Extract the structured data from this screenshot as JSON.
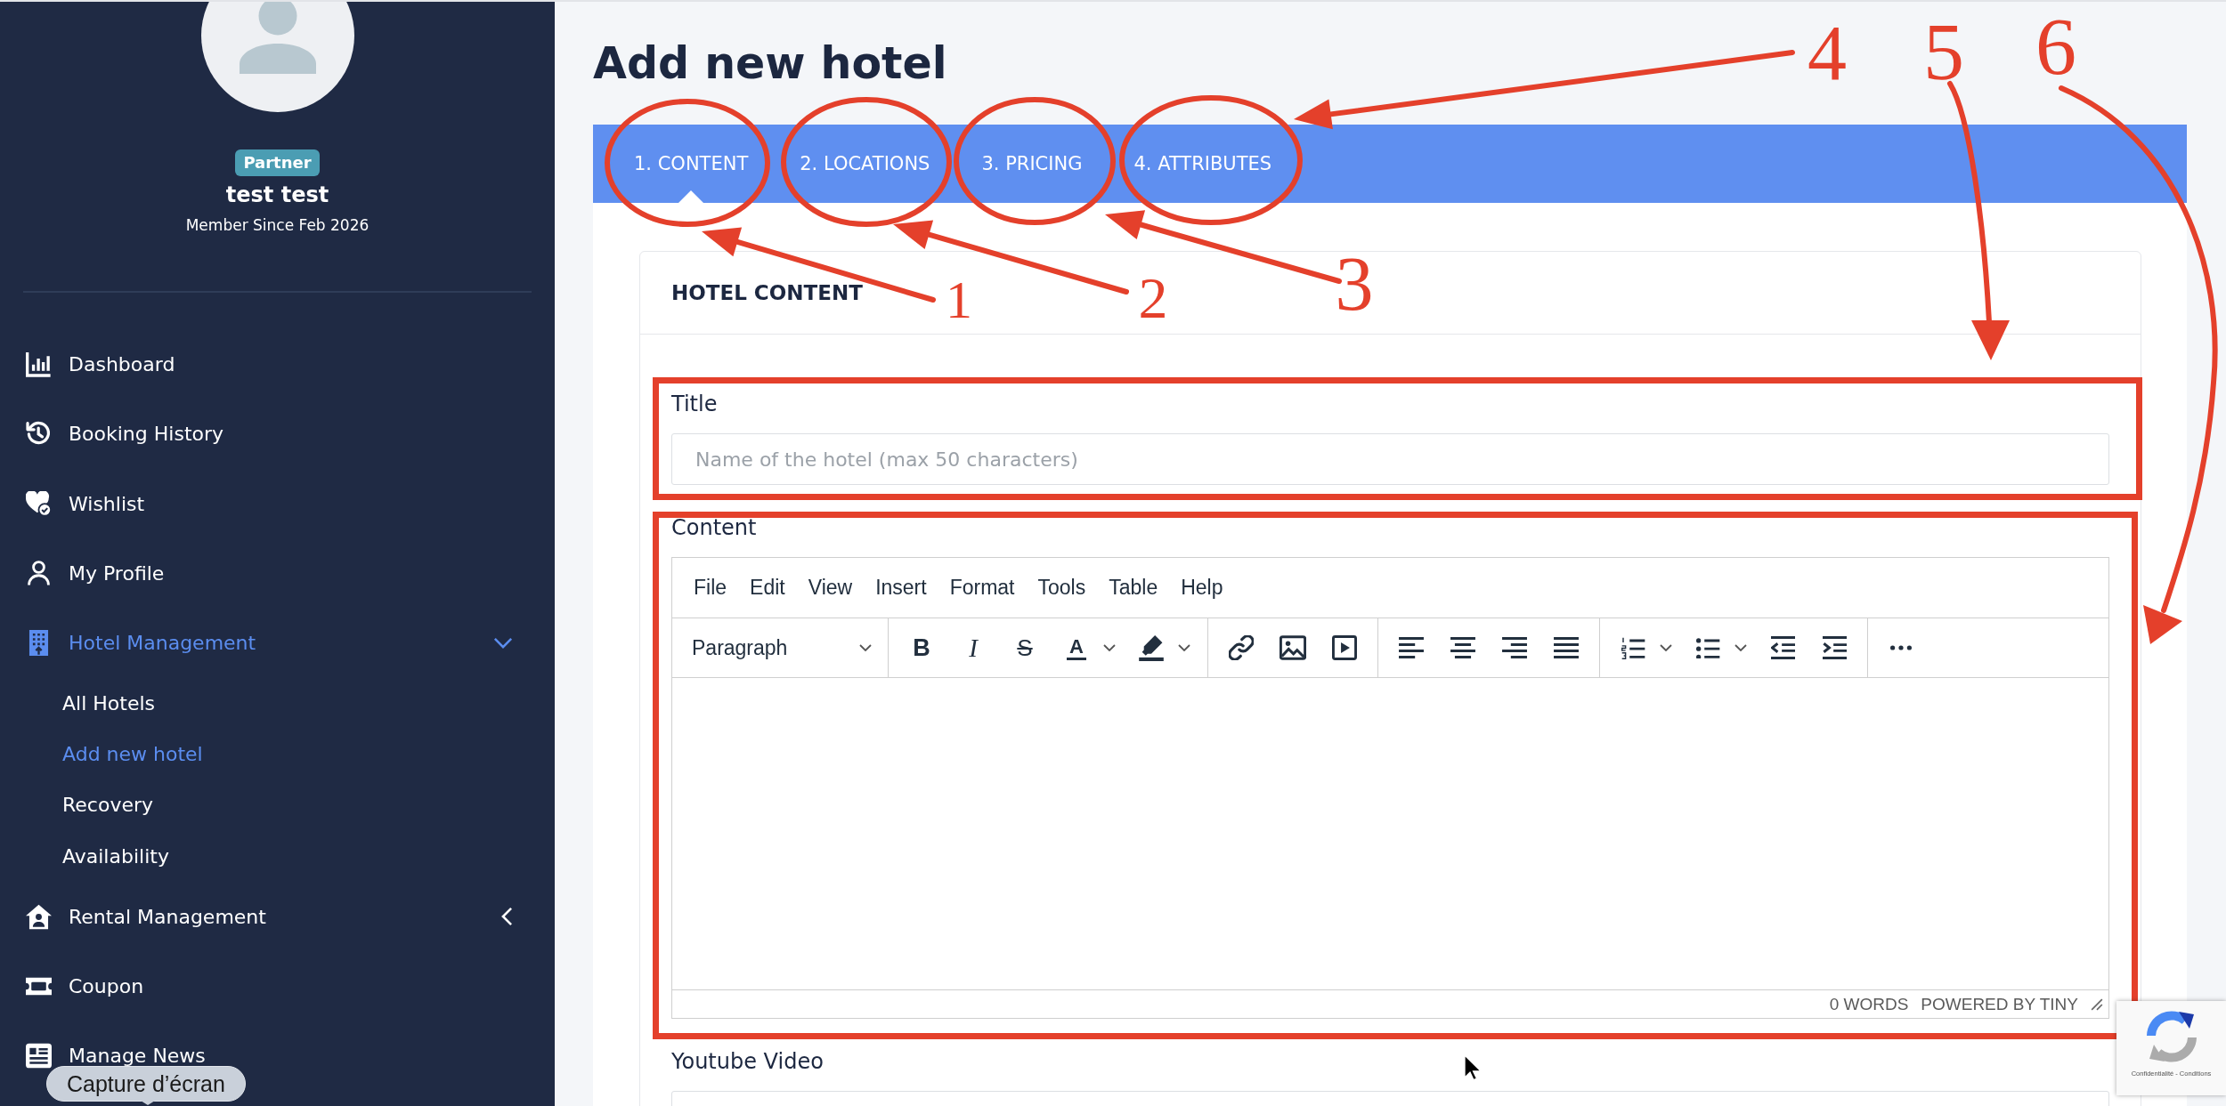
{
  "sidebar": {
    "profile": {
      "badge": "Partner",
      "name": "test test",
      "member_since": "Member Since Feb 2026"
    },
    "items": [
      {
        "kind": "link",
        "label": "Dashboard",
        "selected": false
      },
      {
        "kind": "link",
        "label": "Booking History",
        "selected": false
      },
      {
        "kind": "link",
        "label": "Wishlist",
        "selected": false
      },
      {
        "kind": "link",
        "label": "My Profile",
        "selected": false
      },
      {
        "kind": "group",
        "label": "Hotel Management",
        "selected": true,
        "expanded": true,
        "children": [
          {
            "label": "All Hotels",
            "selected": false
          },
          {
            "label": "Add new hotel",
            "selected": true
          },
          {
            "label": "Recovery",
            "selected": false
          },
          {
            "label": "Availability",
            "selected": false
          }
        ]
      },
      {
        "kind": "group",
        "label": "Rental Management",
        "selected": false,
        "expanded": false
      },
      {
        "kind": "link",
        "label": "Coupon",
        "selected": false
      },
      {
        "kind": "link",
        "label": "Manage News",
        "selected": false
      }
    ]
  },
  "page": {
    "title": "Add new hotel",
    "tabs": [
      {
        "label": "1. CONTENT",
        "selected": true
      },
      {
        "label": "2. LOCATIONS",
        "selected": false
      },
      {
        "label": "3. PRICING",
        "selected": false
      },
      {
        "label": "4. ATTRIBUTES",
        "selected": false
      }
    ],
    "card": {
      "title": "HOTEL CONTENT",
      "fields": [
        {
          "kind": "text",
          "label": "Title",
          "placeholder": "Name of the hotel (max 50 characters)"
        },
        {
          "kind": "editor",
          "label": "Content",
          "menu": [
            "File",
            "Edit",
            "View",
            "Insert",
            "Format",
            "Tools",
            "Table",
            "Help"
          ],
          "toolbar": {
            "block_format": "Paragraph",
            "bold": "B",
            "italic": "I",
            "strikethrough": "S",
            "text_color": "A"
          },
          "word_count": "0 WORDS",
          "branding": "POWERED BY TINY"
        },
        {
          "kind": "text",
          "label": "Youtube Video"
        }
      ]
    }
  },
  "annotations": [
    {
      "label": "1"
    },
    {
      "label": "2"
    },
    {
      "label": "3"
    },
    {
      "label": "4"
    },
    {
      "label": "5"
    },
    {
      "label": "6"
    }
  ],
  "screenshot_tooltip": {
    "text": "Capture d’écran"
  },
  "captcha_badge": {
    "text": "Confidentialité - Conditions"
  }
}
